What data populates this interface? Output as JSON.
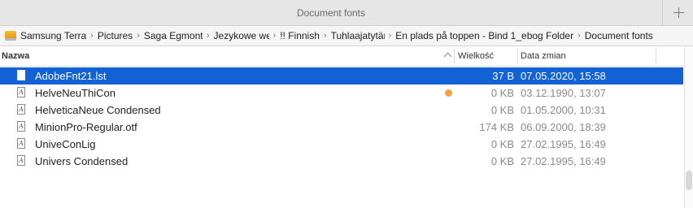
{
  "window": {
    "tab_title": "Document fonts"
  },
  "path": {
    "crumbs": [
      "Samsung Terra",
      "Pictures",
      "Saga Egmont",
      "Jezykowe wersje",
      "!! Finnish",
      "Tuhlaajatytär",
      "En plads på toppen - Bind 1_ebog Folder",
      "Document fonts"
    ]
  },
  "columns": {
    "name": "Nazwa",
    "size": "Wielkość",
    "date": "Data zmian"
  },
  "files": [
    {
      "name": "AdobeFnt21.lst",
      "size": "37 B",
      "date": "07.05.2020, 15:58",
      "selected": true,
      "tagged": false
    },
    {
      "name": "HelveNeuThiCon",
      "size": "0 KB",
      "date": "03.12.1990, 13:07",
      "selected": false,
      "tagged": true
    },
    {
      "name": "HelveticaNeue Condensed",
      "size": "0 KB",
      "date": "01.05.2000, 10:31",
      "selected": false,
      "tagged": false
    },
    {
      "name": "MinionPro-Regular.otf",
      "size": "174 KB",
      "date": "06.09.2000, 18:39",
      "selected": false,
      "tagged": false
    },
    {
      "name": "UniveConLig",
      "size": "0 KB",
      "date": "27.02.1995, 16:49",
      "selected": false,
      "tagged": false
    },
    {
      "name": "Univers Condensed",
      "size": "0 KB",
      "date": "27.02.1995, 16:49",
      "selected": false,
      "tagged": false
    }
  ],
  "colors": {
    "selection": "#1262d6",
    "tag_orange": "#f2a23c"
  },
  "icons": {
    "drive": "drive-icon",
    "file": "font-file-icon",
    "add_tab": "plus-icon"
  }
}
